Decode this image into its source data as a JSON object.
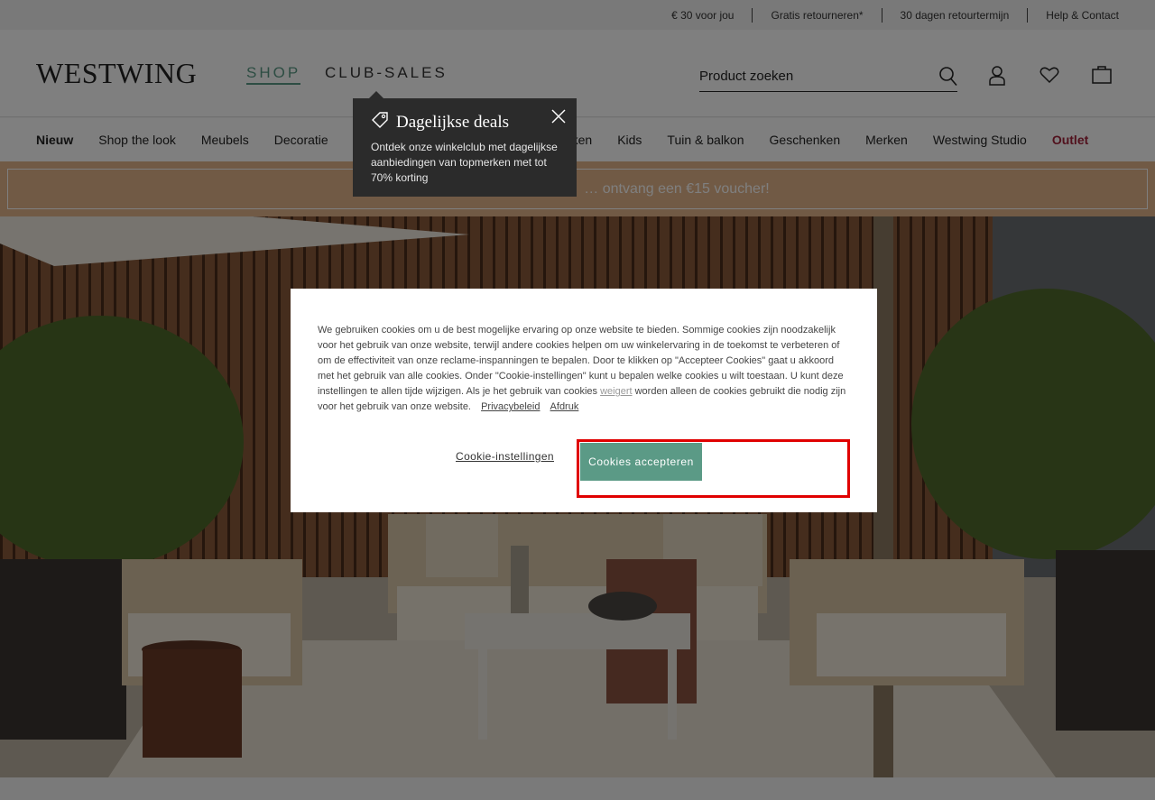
{
  "topbar": {
    "items": [
      "€ 30 voor jou",
      "Gratis retourneren*",
      "30 dagen retourtermijn",
      "Help & Contact"
    ]
  },
  "header": {
    "logo": "WESTWING",
    "tabs": {
      "shop": "SHOP",
      "club": "CLUB-SALES"
    },
    "search_placeholder": "Product zoeken",
    "icons": [
      "search-icon",
      "user-icon",
      "heart-icon",
      "bag-icon"
    ]
  },
  "nav": {
    "categories": [
      "Nieuw",
      "Shop the look",
      "Meubels",
      "Decoratie",
      "Keuken",
      "Kids",
      "Tuin & balkon",
      "Geschenken",
      "Merken",
      "Westwing Studio",
      "Outlet"
    ]
  },
  "promo": {
    "text": "… ontvang een €15 voucher!"
  },
  "tooltip": {
    "title": "Dagelijkse deals",
    "text": "Ontdek onze winkelclub met dagelijkse aanbiedingen van topmerken met tot 70% korting"
  },
  "cookie": {
    "text": "We gebruiken cookies om u de best mogelijke ervaring op onze website te bieden. Sommige cookies zijn noodzakelijk voor het gebruik van onze website, terwijl andere cookies helpen om uw winkelervaring in de toekomst te verbeteren of om de effectiviteit van onze reclame-inspanningen te bepalen. Door te klikken op \"Accepteer Cookies\" gaat u akkoord met het gebruik van alle cookies. Onder \"Cookie-instellingen\" kunt u bepalen welke cookies u wilt toestaan. U kunt deze instellingen te allen tijde wijzigen. Als je het gebruik van cookies",
    "refuse_link": "weigert",
    "text_after": "worden alleen de cookies gebruikt die nodig zijn voor het gebruik van onze website.",
    "privacy_link": "Privacybeleid",
    "imprint_link": "Afdruk",
    "settings_label": "Cookie-instellingen",
    "accept_label": "Cookies accepteren"
  },
  "colors": {
    "accent": "#5b9a86",
    "outlet": "#a3223a",
    "promo": "#e2b48a",
    "highlight": "#e00000"
  }
}
